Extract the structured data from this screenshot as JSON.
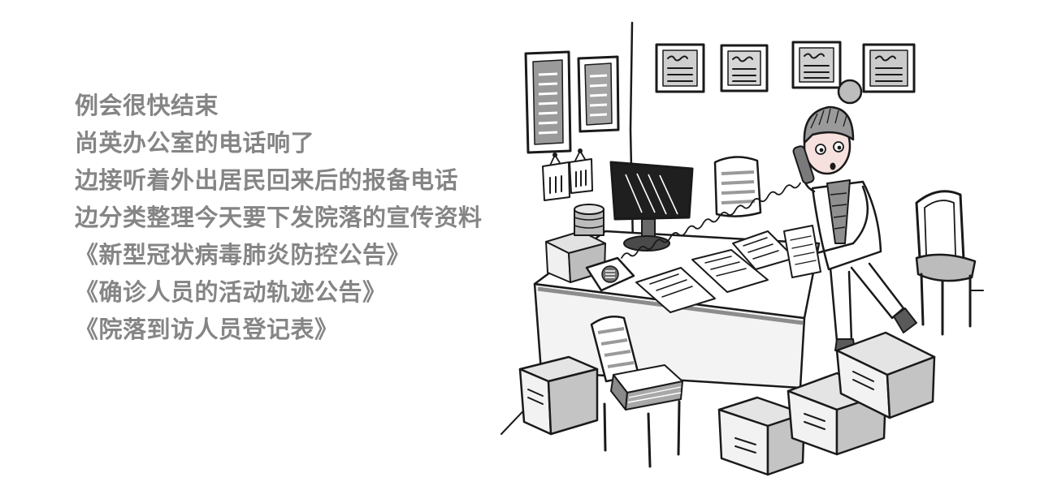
{
  "text_color": "#858585",
  "text_lines": [
    "例会很快结束",
    "尚英办公室的电话响了",
    "边接听着外出居民回来后的报备电话",
    "边分类整理今天要下发院落的宣传资料",
    "《新型冠状病毒肺炎防控公告》",
    "《确诊人员的活动轨迹公告》",
    "《院落到访人员登记表》"
  ]
}
